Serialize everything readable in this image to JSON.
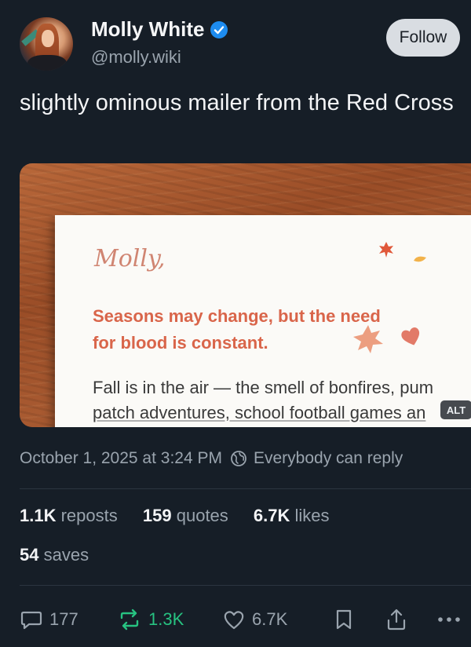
{
  "author": {
    "display_name": "Molly White",
    "handle": "@molly.wiki",
    "verified": true,
    "follow_label": "Follow"
  },
  "post": {
    "text": "slightly ominous mailer from the Red Cross",
    "media": {
      "salutation": "Molly,",
      "headline": "Seasons may change, but the need for blood is constant.",
      "body_line1": "Fall is in the air — the smell of bonfires, pum",
      "body_line2": "patch adventures, school football games an",
      "alt_badge": "ALT"
    },
    "timestamp": "October 1, 2025 at 3:24 PM",
    "reply_setting": "Everybody can reply"
  },
  "stats": {
    "reposts_count": "1.1K",
    "reposts_label": "reposts",
    "quotes_count": "159",
    "quotes_label": "quotes",
    "likes_count": "6.7K",
    "likes_label": "likes",
    "saves_count": "54",
    "saves_label": "saves"
  },
  "actions": {
    "reply_count": "177",
    "repost_count": "1.3K",
    "like_count": "6.7K"
  },
  "colors": {
    "background": "#161e27",
    "verified": "#1d8cf0",
    "repost_active": "#27c281",
    "headline": "#d9654a"
  },
  "icons": [
    "verified-badge-icon",
    "globe-icon",
    "reply-icon",
    "repost-icon",
    "heart-icon",
    "bookmark-icon",
    "share-icon",
    "more-icon",
    "leaf-icon",
    "heart-shape-icon"
  ]
}
